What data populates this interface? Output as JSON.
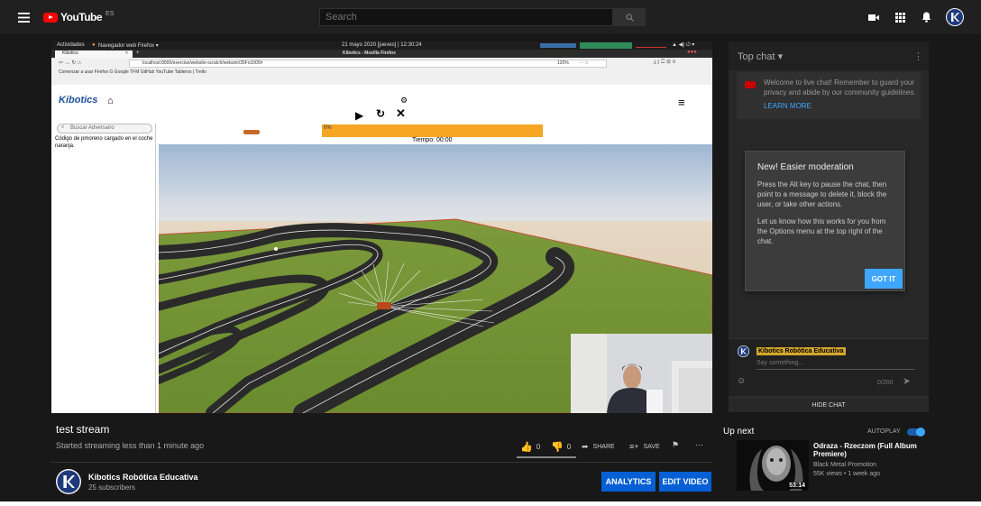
{
  "header": {
    "logo_text": "YouTube",
    "region_code": "ES",
    "search_placeholder": "Search",
    "brand_color": "#ff0000"
  },
  "browser": {
    "gnome_activities": "Actividades",
    "gnome_app": "Navegador web Firefox ▾",
    "gnome_clock": "21 mayo 2020 [jueves] | 12:30:24",
    "window_title": "Kibotics - Mozilla Firefox",
    "tab_title": "Kibotics",
    "url": "localhost:8000/exercise/website-scratch/websim/35Fo1005#",
    "zoom": "120%",
    "bookmarks": "Comenzar a usar Firefox   G Google   TFM   GitHub   YouTube   Tableros | Trello"
  },
  "kibotics": {
    "logo": "Kibotics",
    "search_placeholder": "Buscar Adversario",
    "status_text": "Código de pmoreno cargado en el coche naranja.",
    "progress_label": "0%",
    "timer": "Tiempo: 00:00",
    "progress_color": "#f5a623"
  },
  "video": {
    "title": "test stream",
    "subtitle": "Started streaming less than 1 minute ago",
    "likes": "0",
    "dislikes": "0",
    "share_label": "SHARE",
    "save_label": "SAVE"
  },
  "channel": {
    "name": "Kibotics Robótica Educativa",
    "subscribers": "25 subscribers",
    "analytics_label": "ANALYTICS",
    "edit_label": "EDIT VIDEO"
  },
  "chat": {
    "header": "Top chat ▾",
    "welcome": "Welcome to live chat! Remember to guard your privacy and abide by our community guidelines.",
    "learn_more": "LEARN MORE",
    "modal_title": "New! Easier moderation",
    "modal_p1": "Press the Alt key to pause the chat, then point to a message to delete it, block the user, or take other actions.",
    "modal_p2": "Let us know how this works for you from the Options menu at the top right of the chat.",
    "gotit_label": "GOT IT",
    "author": "Kibotics Robótica Educativa",
    "input_placeholder": "Say something...",
    "counter": "0/200",
    "hide_label": "HIDE CHAT"
  },
  "upnext": {
    "heading": "Up next",
    "autoplay_label": "AUTOPLAY",
    "video_title": "Odraza - Rzeczom (Full Album Premiere)",
    "channel": "Black Metal Promotion",
    "meta": "55K views • 1 week ago",
    "duration": "53:14"
  }
}
